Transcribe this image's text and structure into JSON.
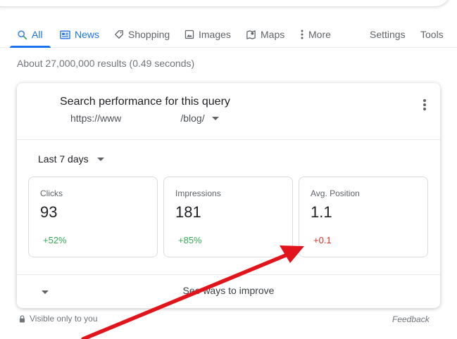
{
  "tabs": [
    {
      "label": "All",
      "icon": "search-icon",
      "active": true
    },
    {
      "label": "News",
      "icon": "news-icon"
    },
    {
      "label": "Shopping",
      "icon": "tag-icon"
    },
    {
      "label": "Images",
      "icon": "image-icon"
    },
    {
      "label": "Maps",
      "icon": "map-icon"
    },
    {
      "label": "More",
      "icon": "more-vert-icon"
    }
  ],
  "tools": {
    "settings": "Settings",
    "tools": "Tools"
  },
  "result_stats": "About 27,000,000 results (0.49 seconds)",
  "card": {
    "title": "Search performance for this query",
    "url_prefix": "https://www",
    "url_suffix": "/blog/",
    "period": "Last 7 days",
    "metrics": [
      {
        "label": "Clicks",
        "value": "93",
        "change": "+52%",
        "trend": "up"
      },
      {
        "label": "Impressions",
        "value": "181",
        "change": "+85%",
        "trend": "up"
      },
      {
        "label": "Avg. Position",
        "value": "1.1",
        "change": "+0.1",
        "trend": "down"
      }
    ],
    "improve": "See ways to improve"
  },
  "footer": {
    "visible_only": "Visible only to you",
    "feedback": "Feedback"
  },
  "colors": {
    "accent": "#1a73e8",
    "positive": "#34a853",
    "negative": "#d93025",
    "annotation_arrow": "#e0141a"
  }
}
